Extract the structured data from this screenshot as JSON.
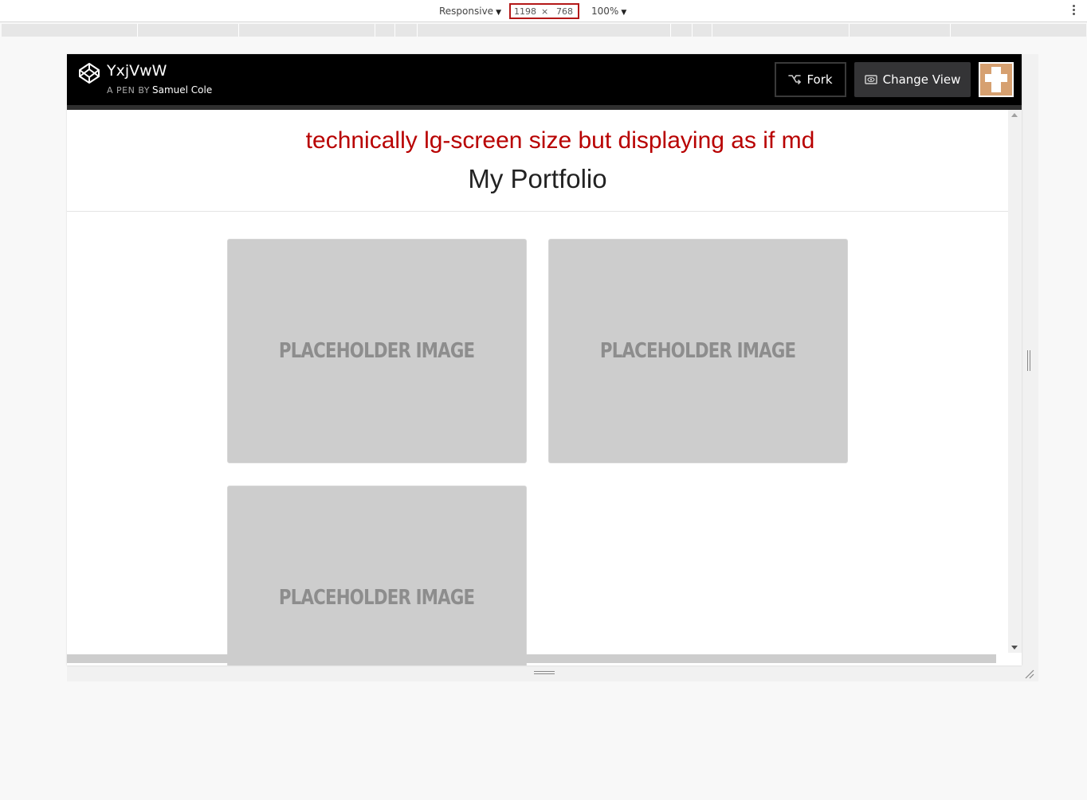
{
  "devtools": {
    "device_label": "Responsive",
    "width_value": "1198",
    "times_sign": "×",
    "height_value": "768",
    "zoom_label": "100%",
    "highlight_color": "#b31818"
  },
  "codepen_header": {
    "pen_title": "YxjVwW",
    "byline_prefix": "A PEN BY",
    "author": "Samuel Cole",
    "fork_label": "Fork",
    "change_view_label": "Change View",
    "icons": [
      "codepen-logo-icon",
      "fork-icon",
      "eye-icon"
    ]
  },
  "page": {
    "subtitle": "technically lg-screen size but displaying as if md",
    "subtitle_color": "#b80000",
    "title": "My Portfolio",
    "placeholders": [
      {
        "label": "PLACEHOLDER IMAGE"
      },
      {
        "label": "PLACEHOLDER IMAGE"
      },
      {
        "label": "PLACEHOLDER IMAGE"
      }
    ]
  }
}
